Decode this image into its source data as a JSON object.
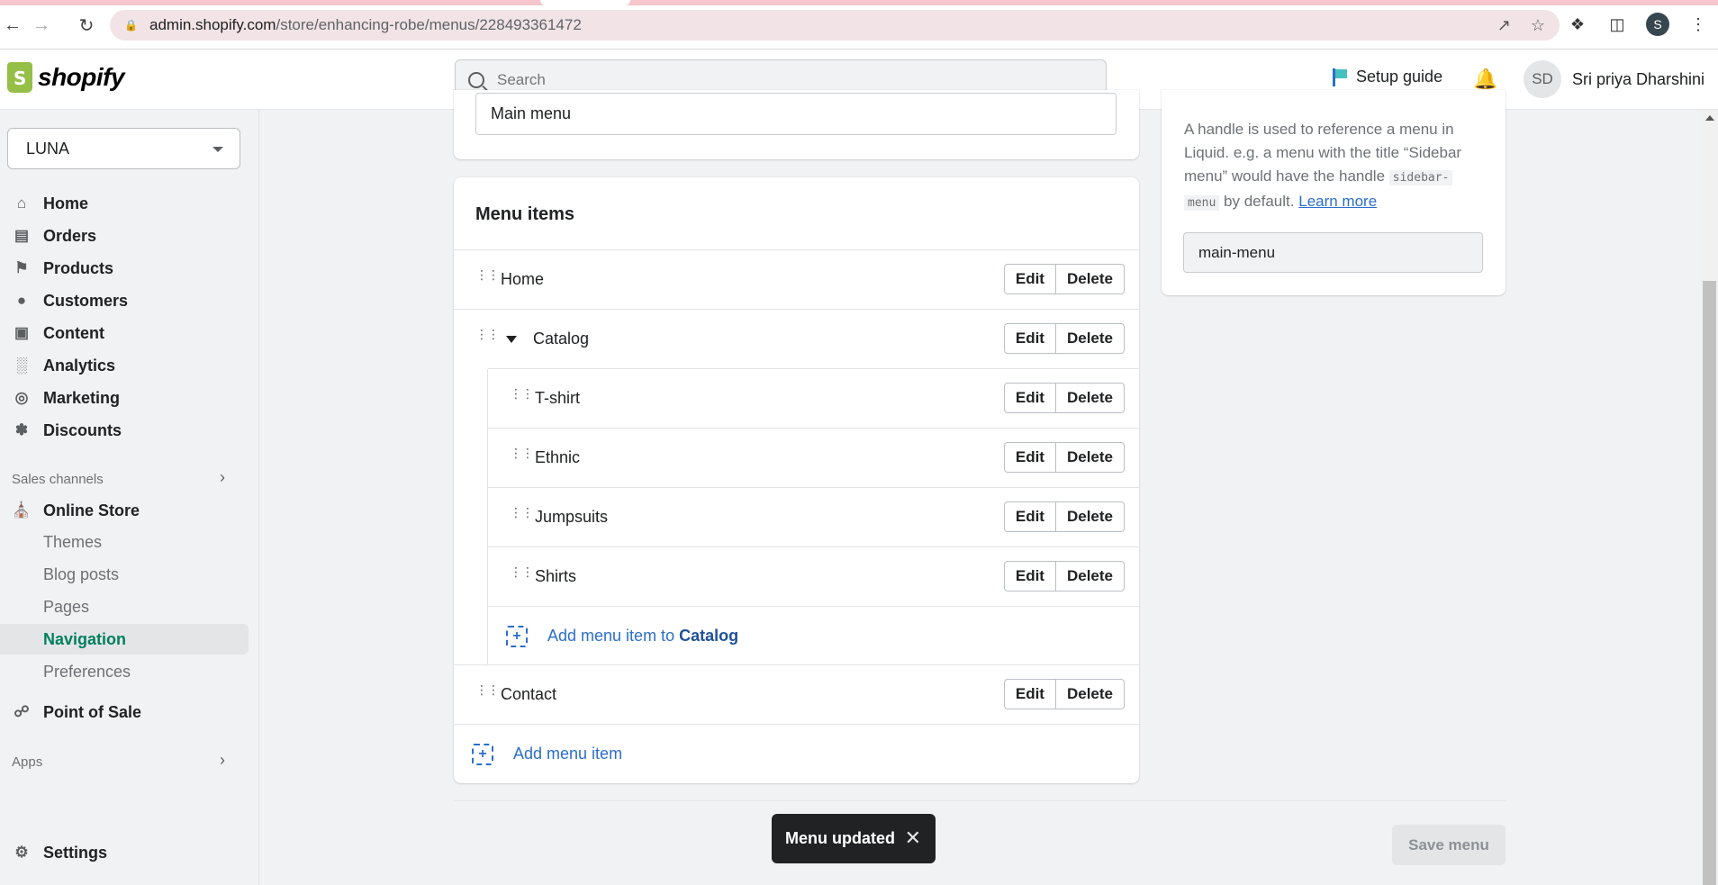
{
  "browser": {
    "url_host": "admin.shopify.com",
    "url_path": "/store/enhancing-robe/menus/228493361472",
    "profile_initial": "S"
  },
  "topbar": {
    "logo_text": "shopify",
    "search_placeholder": "Search",
    "setup_guide": "Setup guide",
    "user_initials": "SD",
    "user_name": "Sri priya Dharshini"
  },
  "sidebar": {
    "store_name": "LUNA",
    "items": [
      {
        "label": "Home",
        "icon": "home-icon"
      },
      {
        "label": "Orders",
        "icon": "orders-icon"
      },
      {
        "label": "Products",
        "icon": "tag-icon"
      },
      {
        "label": "Customers",
        "icon": "person-icon"
      },
      {
        "label": "Content",
        "icon": "content-icon"
      },
      {
        "label": "Analytics",
        "icon": "bar-chart-icon"
      },
      {
        "label": "Marketing",
        "icon": "marketing-icon"
      },
      {
        "label": "Discounts",
        "icon": "discount-icon"
      }
    ],
    "sales_channels_label": "Sales channels",
    "online_store": "Online Store",
    "sub_items": [
      "Themes",
      "Blog posts",
      "Pages",
      "Navigation",
      "Preferences"
    ],
    "active_sub_item": "Navigation",
    "point_of_sale": "Point of Sale",
    "apps_label": "Apps",
    "settings": "Settings"
  },
  "menu": {
    "title_value": "Main menu",
    "items_heading": "Menu items",
    "edit_label": "Edit",
    "delete_label": "Delete",
    "top_items": [
      "Home",
      "Catalog",
      "Contact"
    ],
    "catalog_children": [
      "T-shirt",
      "Ethnic",
      "Jumpsuits",
      "Shirts"
    ],
    "add_to_catalog_prefix": "Add menu item to",
    "add_to_catalog_target": "Catalog",
    "add_menu_item": "Add menu item"
  },
  "handle_card": {
    "desc_1": "A handle is used to reference a menu in Liquid. e.g. a menu with the title “Sidebar menu” would have the handle",
    "code_1": "sidebar-",
    "code_2": "menu",
    "desc_2": "by default.",
    "learn_more": "Learn more",
    "handle_value": "main-menu"
  },
  "toast": {
    "message": "Menu updated"
  },
  "footer": {
    "save_label": "Save menu"
  },
  "colors": {
    "accent_green": "#007f5f",
    "link_blue": "#2c6ecb",
    "toast_bg": "#202223"
  }
}
